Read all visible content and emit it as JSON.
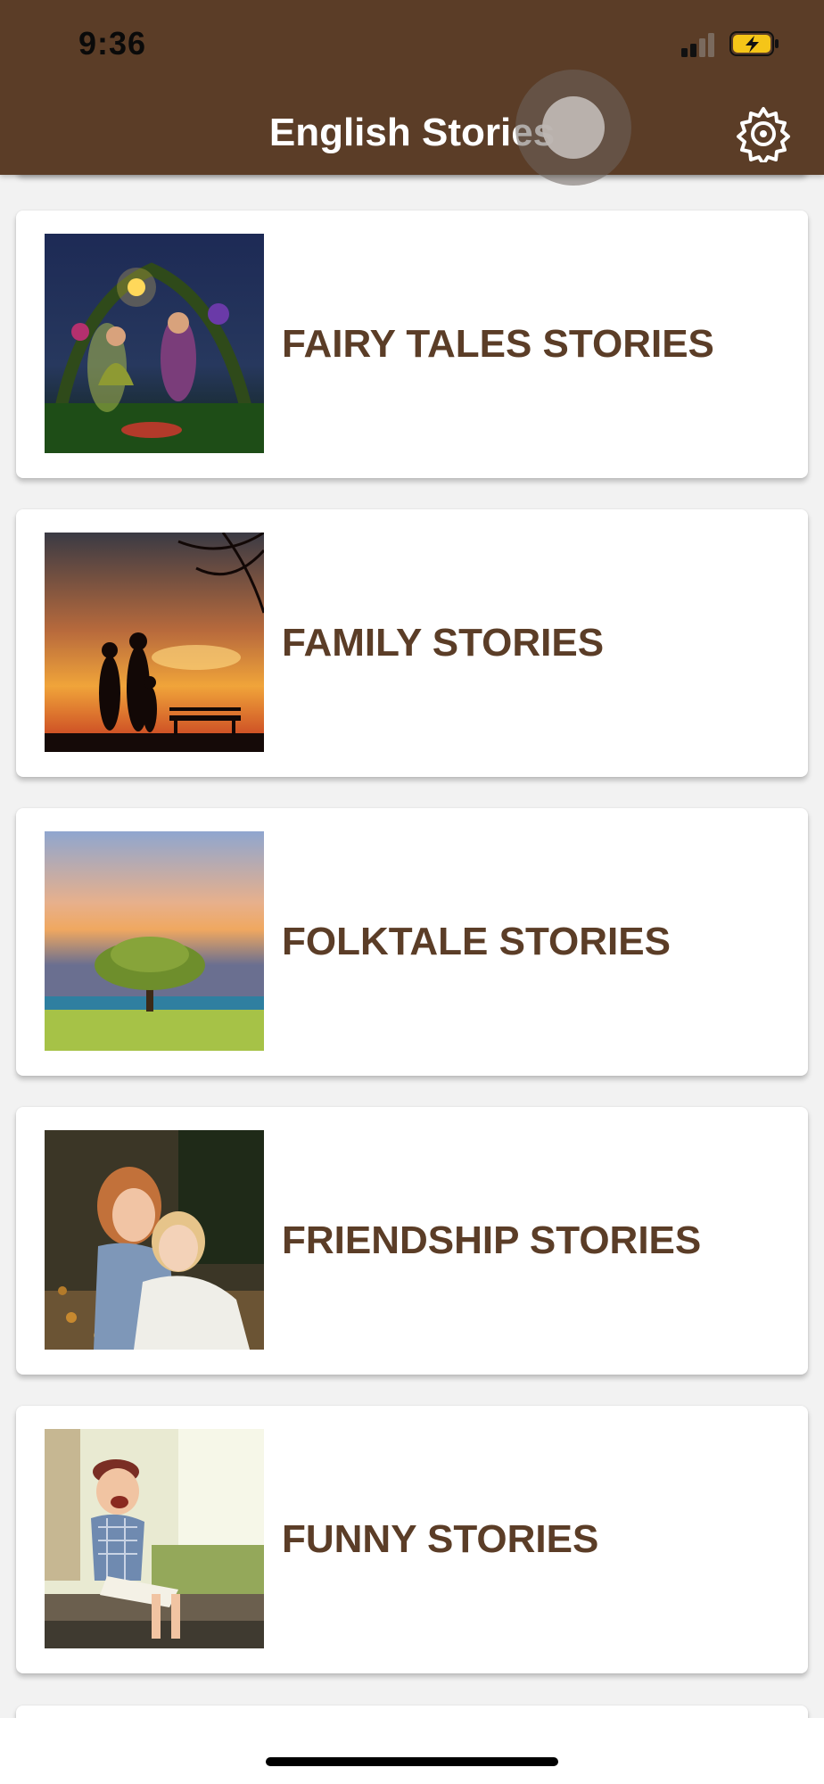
{
  "status_bar": {
    "time": "9:36"
  },
  "header": {
    "title": "English Stories",
    "settings_icon": "settings-gear-icon"
  },
  "colors": {
    "header_bg": "#5b3d27",
    "label_color": "#5b3d27",
    "accent_battery": "#f5c518"
  },
  "categories": [
    {
      "label": "FAIRY TALES STORIES",
      "image": "fairy-scene"
    },
    {
      "label": "FAMILY STORIES",
      "image": "family-sunset"
    },
    {
      "label": "FOLKTALE STORIES",
      "image": "tree-sunset"
    },
    {
      "label": "FRIENDSHIP STORIES",
      "image": "girls-hugging"
    },
    {
      "label": "FUNNY STORIES",
      "image": "laughing-boy"
    }
  ]
}
